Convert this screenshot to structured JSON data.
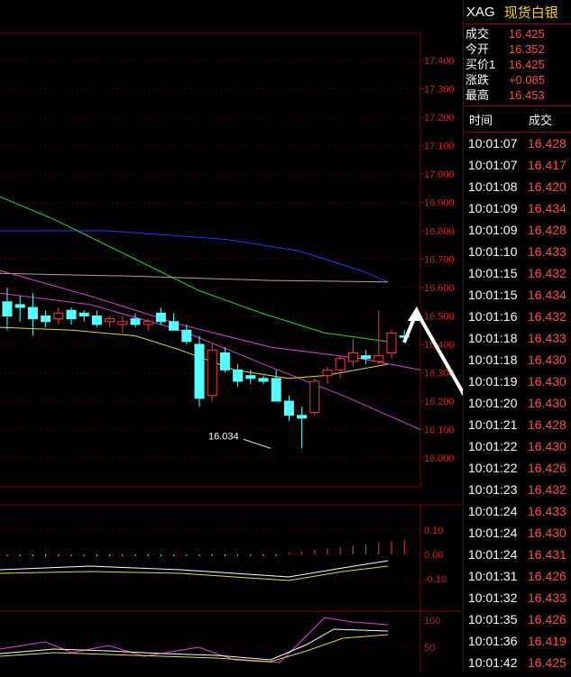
{
  "header": {
    "symbol": "XAG",
    "name": "现货白银"
  },
  "quote": [
    {
      "label": "成交",
      "value": "16.425"
    },
    {
      "label": "今开",
      "value": "16.352"
    },
    {
      "label": "买价1",
      "value": "16.425"
    },
    {
      "label": "涨跌",
      "value": "+0.085"
    },
    {
      "label": "最高",
      "value": "16.453"
    }
  ],
  "trades_header": {
    "time": "时间",
    "price": "成交"
  },
  "trades": [
    {
      "time": "10:01:07",
      "price": "16.428"
    },
    {
      "time": "10:01:07",
      "price": "16.417"
    },
    {
      "time": "10:01:08",
      "price": "16.420"
    },
    {
      "time": "10:01:09",
      "price": "16.434"
    },
    {
      "time": "10:01:09",
      "price": "16.428"
    },
    {
      "time": "10:01:10",
      "price": "16.433"
    },
    {
      "time": "10:01:15",
      "price": "16.432"
    },
    {
      "time": "10:01:15",
      "price": "16.434"
    },
    {
      "time": "10:01:16",
      "price": "16.432"
    },
    {
      "time": "10:01:18",
      "price": "16.433"
    },
    {
      "time": "10:01:18",
      "price": "16.430"
    },
    {
      "time": "10:01:19",
      "price": "16.430"
    },
    {
      "time": "10:01:20",
      "price": "16.430"
    },
    {
      "time": "10:01:21",
      "price": "16.428"
    },
    {
      "time": "10:01:22",
      "price": "16.430"
    },
    {
      "time": "10:01:22",
      "price": "16.426"
    },
    {
      "time": "10:01:23",
      "price": "16.432"
    },
    {
      "time": "10:01:24",
      "price": "16.433"
    },
    {
      "time": "10:01:24",
      "price": "16.430"
    },
    {
      "time": "10:01:24",
      "price": "16.431"
    },
    {
      "time": "10:01:31",
      "price": "16.426"
    },
    {
      "time": "10:01:32",
      "price": "16.433"
    },
    {
      "time": "10:01:35",
      "price": "16.426"
    },
    {
      "time": "10:01:36",
      "price": "16.419"
    },
    {
      "time": "10:01:42",
      "price": "16.425"
    }
  ],
  "chart": {
    "price_ticks": [
      "17.400",
      "17.300",
      "17.200",
      "17.100",
      "17.000",
      "16.900",
      "16.800",
      "16.700",
      "16.600",
      "16.500",
      "16.400",
      "16.300",
      "16.200",
      "16.100",
      "16.000"
    ],
    "macd_ticks": [
      "0.10",
      "0.00",
      "-0.10"
    ],
    "kdj_ticks": [
      "100",
      "50"
    ],
    "low_label": "16.034",
    "colors": {
      "up": "#ff3b3b",
      "down": "#54ffff",
      "grid": "#7a0000",
      "axis_text": "#cc2222"
    }
  }
}
